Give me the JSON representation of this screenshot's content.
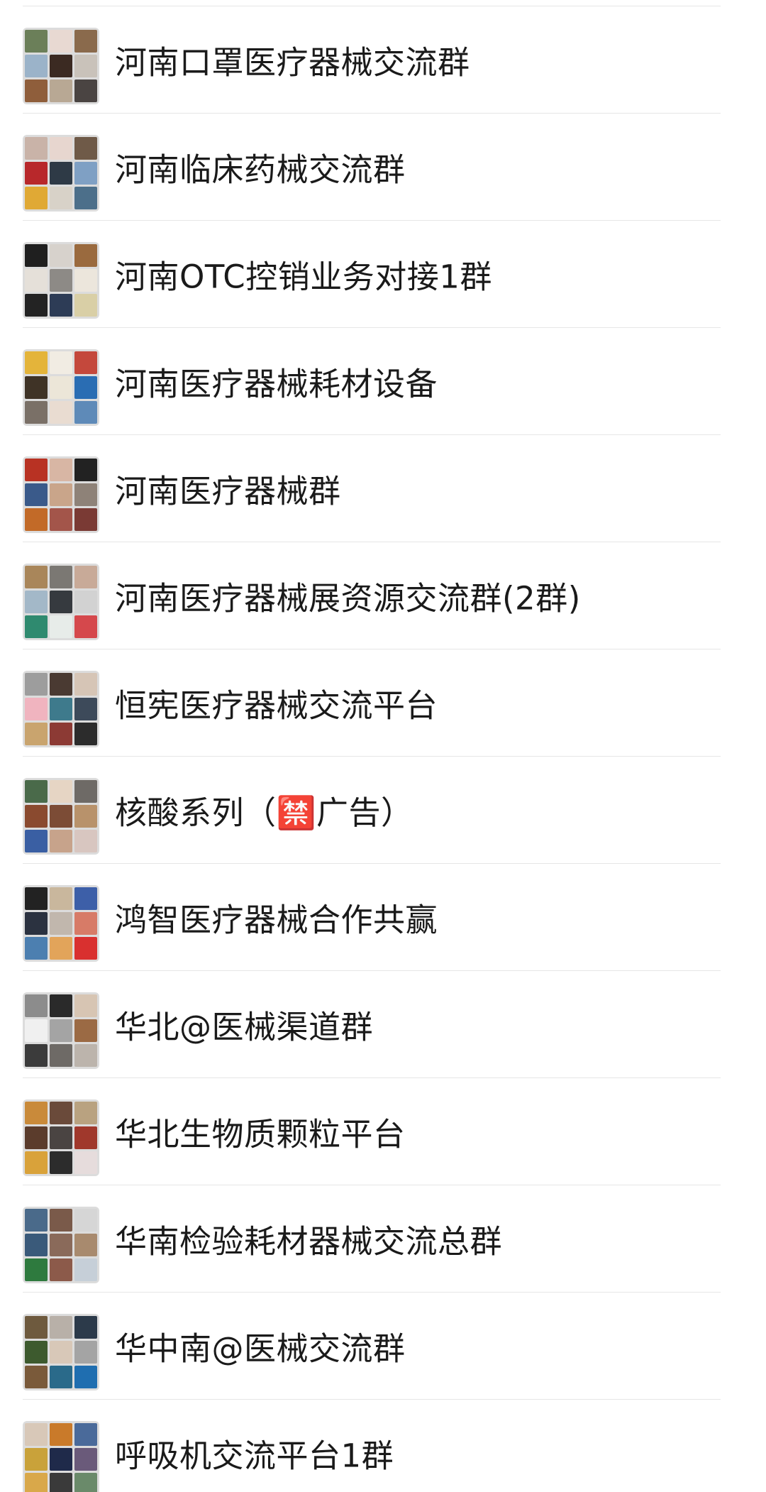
{
  "groups": [
    {
      "name": "河南口罩医疗器械交流群",
      "avatar_colors": [
        "#6b7f59",
        "#e8d9d2",
        "#8a6a4c",
        "#9bb3c9",
        "#3b2a22",
        "#c9c2ba",
        "#8f5e3b",
        "#b8a894",
        "#4a4442"
      ]
    },
    {
      "name": "河南临床药械交流群",
      "avatar_colors": [
        "#c9b3a8",
        "#e7d6cf",
        "#6f5a48",
        "#b8282b",
        "#2e3a46",
        "#7fa0c4",
        "#e0a935",
        "#d8d2c8",
        "#4c6f8a"
      ]
    },
    {
      "name": "河南OTC控销业务对接1群",
      "avatar_colors": [
        "#1f1f1f",
        "#d7d2cc",
        "#9a6a3e",
        "#e5e0d9",
        "#8d8a86",
        "#ece6dc",
        "#232323",
        "#2d3c56",
        "#d9cfa6"
      ]
    },
    {
      "name": "河南医疗器械耗材设备",
      "avatar_colors": [
        "#e4b43a",
        "#f1ece3",
        "#c4483c",
        "#3f3326",
        "#ece6d8",
        "#2a6db3",
        "#7a7067",
        "#e9dcd1",
        "#5e8ab8"
      ]
    },
    {
      "name": "河南医疗器械群",
      "avatar_colors": [
        "#b83223",
        "#d8b6a4",
        "#222222",
        "#3a5a8a",
        "#c9a58a",
        "#8e8278",
        "#c26a28",
        "#a3554a",
        "#7a3a34"
      ]
    },
    {
      "name": "河南医疗器械展资源交流群(2群)",
      "avatar_colors": [
        "#a9865a",
        "#7b7873",
        "#c8aa98",
        "#a3b8c8",
        "#363a3f",
        "#d2d2d2",
        "#2f8a6f",
        "#e7ece9",
        "#d5484c"
      ]
    },
    {
      "name": "恒宪医疗器械交流平台",
      "avatar_colors": [
        "#9d9d9d",
        "#4a3a32",
        "#d6c5b6",
        "#f0b4bf",
        "#3e7a8c",
        "#3d4a5a",
        "#c9a46e",
        "#8c3a34",
        "#2c2c2c"
      ]
    },
    {
      "name": "核酸系列（🈲广告）",
      "avatar_colors": [
        "#4a6a4a",
        "#e6d5c4",
        "#6e6a66",
        "#8a4a2f",
        "#7c4c36",
        "#b8926b",
        "#3a5fa3",
        "#c7a38b",
        "#d8c6c0"
      ]
    },
    {
      "name": "鸿智医疗器械合作共赢",
      "avatar_colors": [
        "#222222",
        "#c9b79d",
        "#3d5fa8",
        "#2b3240",
        "#c1b7ad",
        "#d77b67",
        "#4c7fb0",
        "#e2a45a",
        "#d9302f"
      ]
    },
    {
      "name": "华北@医械渠道群",
      "avatar_colors": [
        "#8c8c8c",
        "#2a2a2a",
        "#d7c5b3",
        "#f0f0f0",
        "#a4a4a4",
        "#9b6a44",
        "#3b3b3b",
        "#6e6a66",
        "#bcb4ac"
      ]
    },
    {
      "name": "华北生物质颗粒平台",
      "avatar_colors": [
        "#c98a3a",
        "#6a4a3a",
        "#b9a280",
        "#5b3c2c",
        "#4a4442",
        "#a0382c",
        "#d9a23a",
        "#2c2c2c",
        "#e6dcdc"
      ]
    },
    {
      "name": "华南检验耗材器械交流总群",
      "avatar_colors": [
        "#4a6a8a",
        "#7a5a4a",
        "#d6d6d6",
        "#3a5a7a",
        "#8a6a5a",
        "#a88a6e",
        "#2e7a3e",
        "#8c5a4a",
        "#c6cfd8"
      ]
    },
    {
      "name": "华中南@医械交流群",
      "avatar_colors": [
        "#6e5a3e",
        "#b8b0a8",
        "#2c3a4a",
        "#3d5a2e",
        "#d8c8b8",
        "#a4a4a4",
        "#7a5a3a",
        "#2a6a8a",
        "#1f6eb0"
      ]
    },
    {
      "name": "呼吸机交流平台1群",
      "avatar_colors": [
        "#d8c8b8",
        "#c97a2a",
        "#4a6a9a",
        "#c9a23a",
        "#1f2a4a",
        "#6a5a7a",
        "#d9a84a",
        "#3a3a3a",
        "#6a8a6a"
      ]
    }
  ]
}
